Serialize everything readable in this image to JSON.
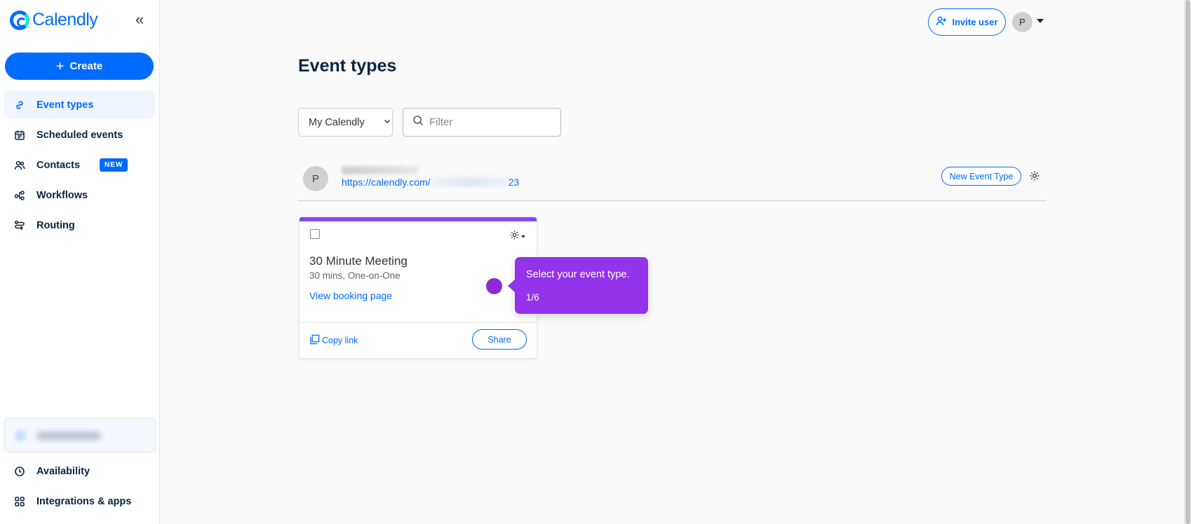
{
  "app": {
    "logo_text": "Calendly"
  },
  "sidebar": {
    "create_label": "Create",
    "items": [
      {
        "label": "Event types",
        "icon": "link-icon",
        "active": true
      },
      {
        "label": "Scheduled events",
        "icon": "calendar-icon"
      },
      {
        "label": "Contacts",
        "icon": "contacts-icon",
        "badge": "NEW"
      },
      {
        "label": "Workflows",
        "icon": "workflow-icon"
      },
      {
        "label": "Routing",
        "icon": "routing-icon"
      }
    ],
    "bottom_items": [
      {
        "label": "Availability",
        "icon": "clock-icon"
      },
      {
        "label": "Integrations & apps",
        "icon": "grid-icon"
      }
    ]
  },
  "topbar": {
    "invite_label": "Invite user",
    "avatar_initial": "P"
  },
  "main": {
    "title": "Event types",
    "select_label": "My Calendly",
    "filter_placeholder": "Filter",
    "user": {
      "initial": "P",
      "link_prefix": "https://calendly.com/",
      "link_suffix": "23"
    },
    "new_event_label": "New Event Type",
    "card": {
      "title": "30 Minute Meeting",
      "subtitle": "30 mins, One-on-One",
      "view_link": "View booking page",
      "copy_label": "Copy link",
      "share_label": "Share",
      "accent_color": "#8247f5"
    }
  },
  "guide": {
    "text": "Select your event type.",
    "step": "1/6",
    "color": "#9333ea"
  },
  "colors": {
    "primary": "#006bff"
  }
}
